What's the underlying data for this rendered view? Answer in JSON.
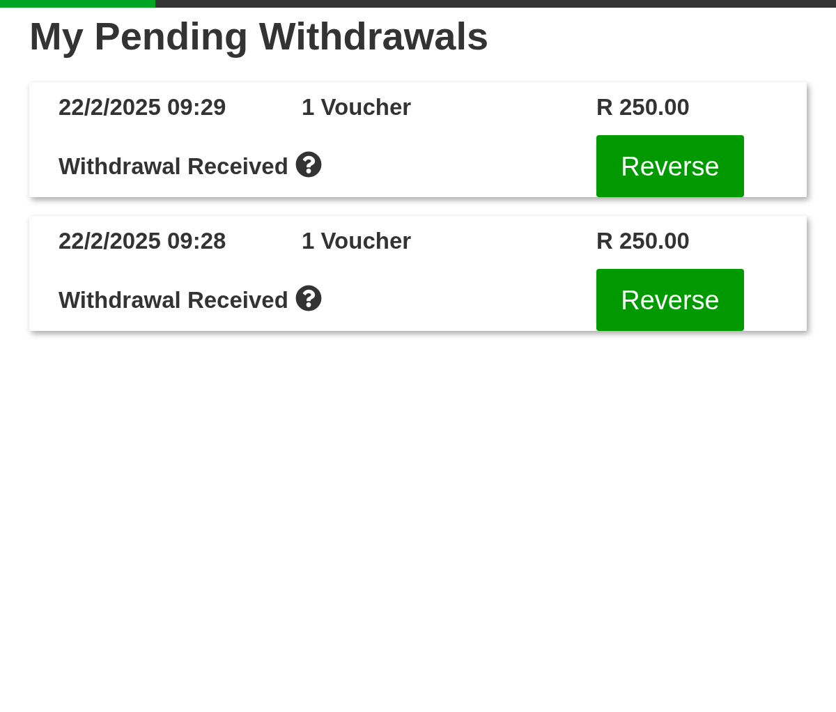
{
  "progress_bar": {
    "level": 0.186
  },
  "title": "My Pending Withdrawals",
  "withdrawals": [
    {
      "date": "22/2/2025 09:29",
      "quantity": "1 Voucher",
      "amount": "R 250.00",
      "status": "Withdrawal Received",
      "action": "Reverse"
    },
    {
      "date": "22/2/2025 09:28",
      "quantity": "1 Voucher",
      "amount": "R 250.00",
      "status": "Withdrawal Received",
      "action": "Reverse"
    }
  ]
}
